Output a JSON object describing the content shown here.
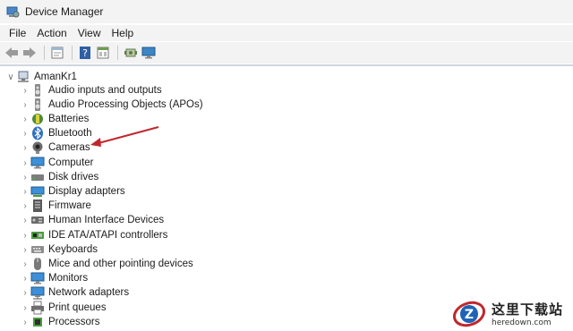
{
  "window": {
    "title": "Device Manager"
  },
  "menu": [
    "File",
    "Action",
    "View",
    "Help"
  ],
  "toolbar": {
    "buttons": [
      "back-icon",
      "forward-icon",
      "properties-icon",
      "help-icon",
      "view-icon",
      "scan-icon",
      "monitor-icon"
    ]
  },
  "tree": {
    "root": {
      "label": "AmanKr1",
      "expanded": true
    },
    "items": [
      {
        "label": "Audio inputs and outputs",
        "icon": "speaker-icon"
      },
      {
        "label": "Audio Processing Objects (APOs)",
        "icon": "speaker-icon"
      },
      {
        "label": "Batteries",
        "icon": "battery-icon"
      },
      {
        "label": "Bluetooth",
        "icon": "bluetooth-icon"
      },
      {
        "label": "Cameras",
        "icon": "camera-icon"
      },
      {
        "label": "Computer",
        "icon": "computer-icon"
      },
      {
        "label": "Disk drives",
        "icon": "disk-icon"
      },
      {
        "label": "Display adapters",
        "icon": "display-adapter-icon"
      },
      {
        "label": "Firmware",
        "icon": "firmware-icon"
      },
      {
        "label": "Human Interface Devices",
        "icon": "hid-icon"
      },
      {
        "label": "IDE ATA/ATAPI controllers",
        "icon": "ide-icon"
      },
      {
        "label": "Keyboards",
        "icon": "keyboard-icon"
      },
      {
        "label": "Mice and other pointing devices",
        "icon": "mouse-icon"
      },
      {
        "label": "Monitors",
        "icon": "monitor-icon"
      },
      {
        "label": "Network adapters",
        "icon": "network-icon"
      },
      {
        "label": "Print queues",
        "icon": "printer-icon"
      },
      {
        "label": "Processors",
        "icon": "processor-icon"
      }
    ]
  },
  "watermark": {
    "cn": "这里下载站",
    "en": "heredown.com"
  },
  "colors": {
    "accent_arrow": "#c0282d",
    "divider": "#cfd6de",
    "chrome": "#f3f3f3"
  }
}
